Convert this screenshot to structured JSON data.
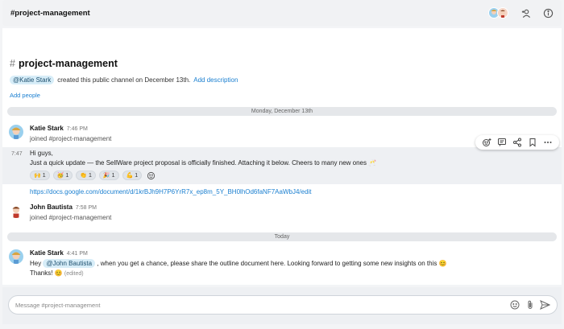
{
  "header": {
    "title": "#project-management"
  },
  "intro": {
    "channel_name": "project-management",
    "creator_mention": "@Katie Stark",
    "created_text": "created this public channel on December 13th.",
    "add_description": "Add description",
    "add_people": "Add people"
  },
  "dividers": {
    "first": "Monday, December 13th",
    "second": "Today"
  },
  "messages": [
    {
      "author": "Katie Stark",
      "time": "7:46 PM",
      "text": "joined #project-management"
    },
    {
      "time": "7:47",
      "lines": [
        "Hi guys,",
        "Just a quick update — the SellWare project proposal is officially finished. Attaching it below. Cheers to many new ones 🥂"
      ],
      "reactions": [
        {
          "emoji": "🙌",
          "count": "1"
        },
        {
          "emoji": "🥳",
          "count": "1"
        },
        {
          "emoji": "👏",
          "count": "1"
        },
        {
          "emoji": "🎉",
          "count": "1"
        },
        {
          "emoji": "💪",
          "count": "1"
        }
      ],
      "link": "https://docs.google.com/document/d/1krBJh9H7P6YrR7x_ep8m_5Y_BH0lhOd6faNF7AaWbJ4/edit"
    },
    {
      "author": "John Bautista",
      "time": "7:58 PM",
      "text": "joined #project-management"
    },
    {
      "author": "Katie Stark",
      "time": "4:41 PM",
      "prefix": "Hey",
      "mention": "@John Bautista",
      "suffix": ", when you get a chance, please share the outline document here. Looking forward to getting some new insights on this 😊",
      "line2": "Thanks! 😊",
      "edited": "(edited)"
    }
  ],
  "composer": {
    "placeholder": "Message #project-management"
  },
  "icons": {
    "header": [
      "add-person-icon",
      "info-icon"
    ],
    "toolbar": [
      "add-reaction-icon",
      "reply-thread-icon",
      "share-icon",
      "bookmark-icon",
      "more-icon"
    ],
    "composer": [
      "emoji-icon",
      "attach-icon",
      "send-icon"
    ]
  }
}
